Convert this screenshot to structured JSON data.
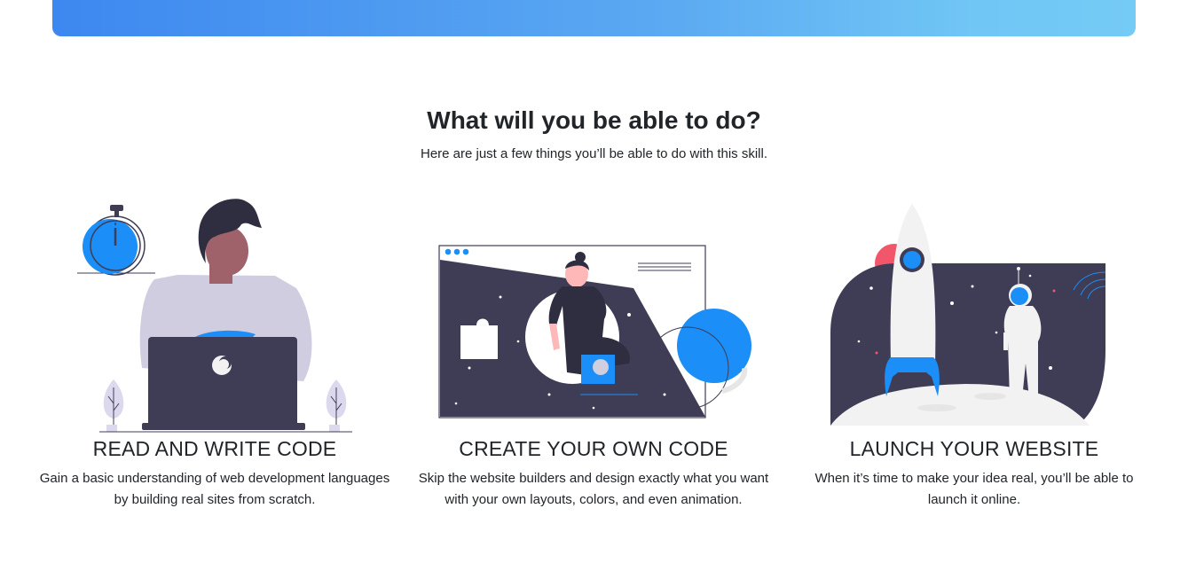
{
  "section": {
    "title": "What will you be able to do?",
    "subtitle": "Here are just a few things you’ll be able to do with this skill."
  },
  "features": [
    {
      "heading": "READ AND WRITE CODE",
      "description": "Gain a basic understanding of web development languages by building real sites from scratch.",
      "illustration": "developer-laptop-illustration"
    },
    {
      "heading": "CREATE YOUR OWN CODE",
      "description": "Skip the website builders and design exactly what you want with your own layouts, colors, and even animation.",
      "illustration": "browser-puzzle-illustration"
    },
    {
      "heading": "LAUNCH YOUR WEBSITE",
      "description": "When it’s time to make your idea real, you’ll be able to launch it online.",
      "illustration": "rocket-astronaut-illustration"
    }
  ],
  "colors": {
    "accent": "#1b8ef7",
    "dark": "#3f3d56",
    "gradient_start": "#3d88f0",
    "gradient_end": "#74cbf5"
  }
}
